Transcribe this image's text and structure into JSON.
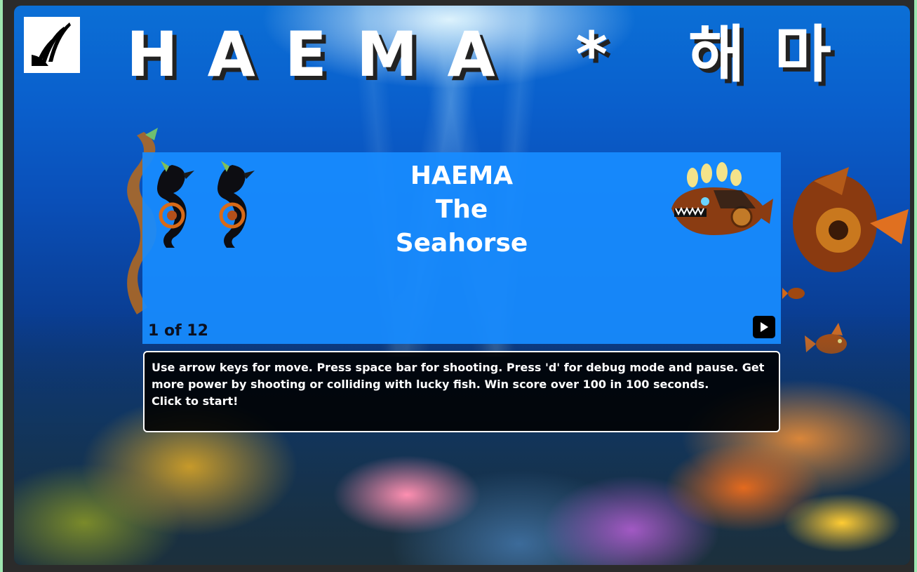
{
  "header": {
    "title": "HAEMA * 해마",
    "logo_icon": "wing-logo-icon"
  },
  "card": {
    "name_line1": "HAEMA",
    "name_line2": "The",
    "name_line3": "Seahorse",
    "counter": "1 of 12",
    "next_icon": "play-next-icon",
    "lives_icons": [
      "seahorse-icon",
      "seahorse-icon"
    ],
    "enemy_icon": "steampunk-anglerfish-icon"
  },
  "instructions": {
    "line1": "Use arrow keys for move. Press space bar for shooting. Press 'd' for debug mode and pause. Get more power by shooting or colliding with lucky fish. Win score over 100 in 100 seconds.",
    "line2": "Click to start!"
  },
  "colors": {
    "panel": "#188cff",
    "instructions_bg": "#000000",
    "frame_border": "#9ee6b0"
  }
}
